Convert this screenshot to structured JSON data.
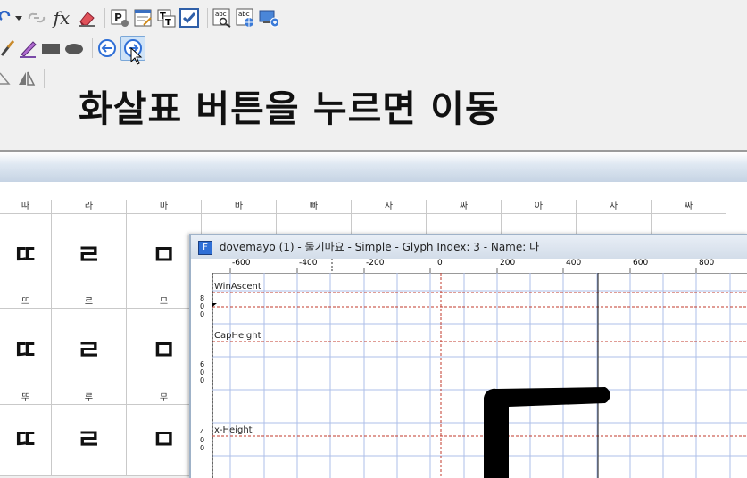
{
  "caption": "화살표 버튼을 누르면 이동",
  "toolbar": {
    "row1_icons": [
      "redo-icon",
      "dropdown-arrow-icon",
      "link-icon",
      "fx-icon",
      "eraser-icon",
      "glyph-info-icon",
      "edit-list-icon",
      "truetype-icon",
      "checkmark-icon",
      "abc-search-icon",
      "abc-globe-icon",
      "output-icon"
    ],
    "fx_text": "fx",
    "row2_icons": [
      "brush-icon",
      "pen-icon",
      "rectangle-icon",
      "ellipse-icon",
      "arrow-left-icon",
      "arrow-right-icon"
    ],
    "row3_icons": [
      "skew-icon",
      "flip-icon"
    ]
  },
  "glyph_grid": {
    "columns": [
      {
        "top": "따",
        "glyph": "ㄸ"
      },
      {
        "top": "라",
        "glyph": "ㄹ"
      },
      {
        "top": "마",
        "glyph": "ㅁ"
      },
      {
        "top": "바",
        "glyph": ""
      },
      {
        "top": "빠",
        "glyph": ""
      },
      {
        "top": "사",
        "glyph": ""
      },
      {
        "top": "싸",
        "glyph": ""
      },
      {
        "top": "아",
        "glyph": ""
      },
      {
        "top": "자",
        "glyph": ""
      },
      {
        "top": "짜",
        "glyph": ""
      }
    ],
    "row2_labels": [
      "뜨",
      "르",
      "므"
    ],
    "row3_labels": [
      "뚜",
      "루",
      "무"
    ],
    "row_glyphs": [
      "ㄸ",
      "ㄹ",
      "ㅁ"
    ]
  },
  "editor": {
    "title": "dovemayo (1) - 둘기마요 - Simple - Glyph Index: 3 - Name: 다",
    "ruler_h_ticks": [
      "-600",
      "-400",
      "-200",
      "0",
      "200",
      "400",
      "600",
      "800"
    ],
    "ruler_v_ticks": [
      "8 0 0",
      "6 0 0",
      "4 0 0"
    ],
    "guides": [
      {
        "label": "WinAscent"
      },
      {
        "label": "CapHeight"
      },
      {
        "label": "x-Height"
      }
    ]
  },
  "colors": {
    "guide_red": "#c0392b",
    "grid_blue": "#aebfe8",
    "accent_blue": "#2f6fd6"
  }
}
